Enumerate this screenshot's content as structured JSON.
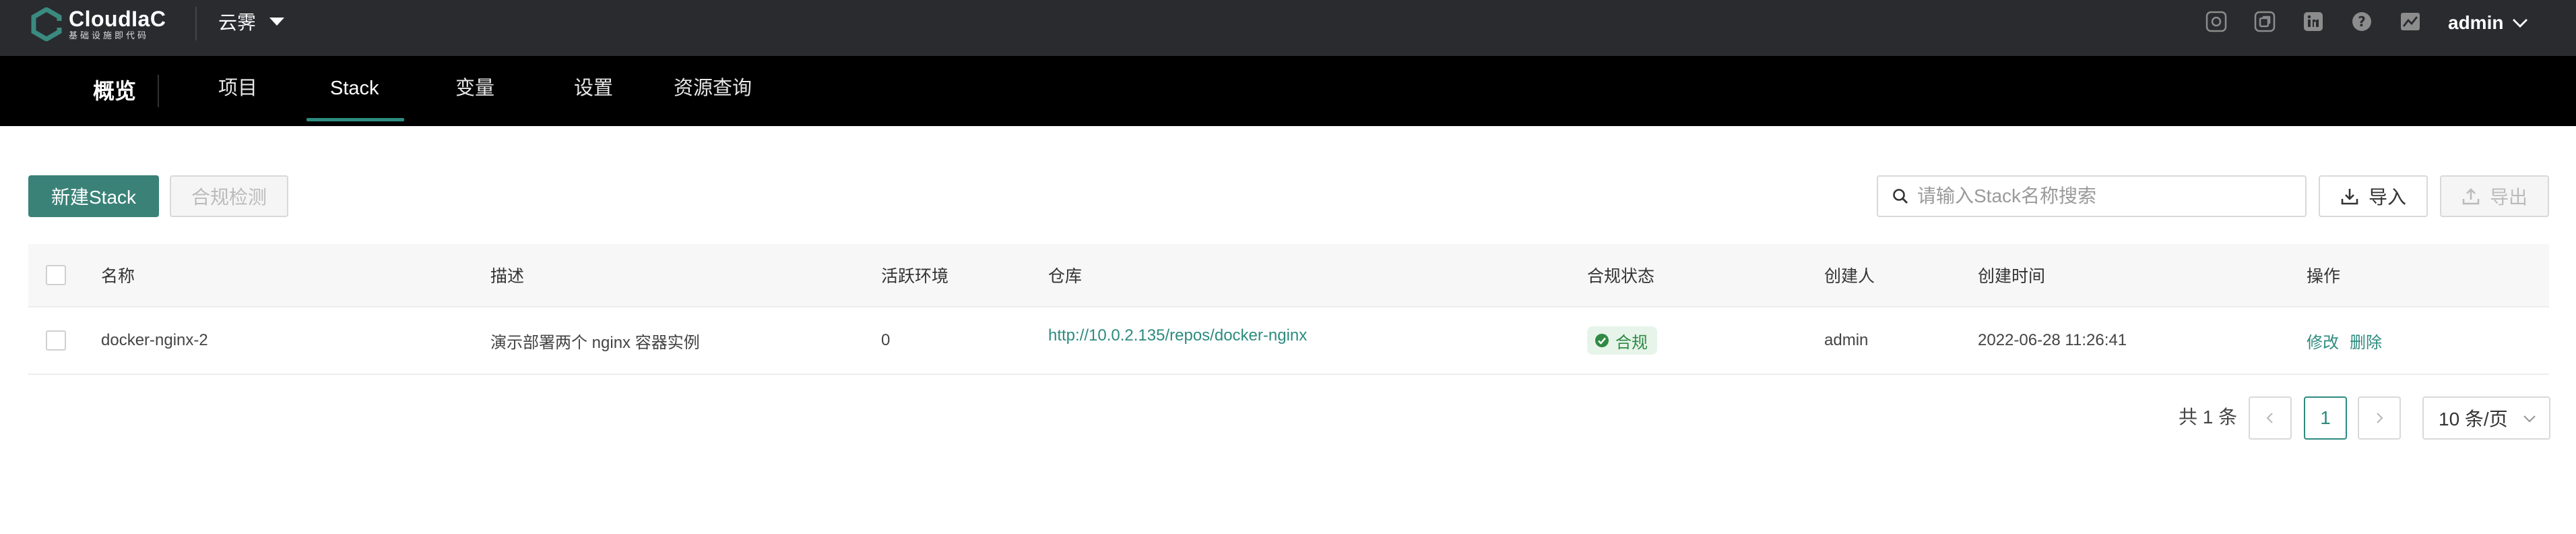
{
  "app": {
    "logo_title": "CloudIaC",
    "logo_subtitle": "基础设施即代码",
    "org": "云霁",
    "user": "admin"
  },
  "top_icons": [
    "gear-icon",
    "copy-icon",
    "linkedin-icon",
    "help-icon",
    "chart-icon"
  ],
  "nav": {
    "overview": "概览",
    "tabs": [
      {
        "label": "项目",
        "active": false
      },
      {
        "label": "Stack",
        "active": true
      },
      {
        "label": "变量",
        "active": false
      },
      {
        "label": "设置",
        "active": false
      },
      {
        "label": "资源查询",
        "active": false
      }
    ]
  },
  "toolbar": {
    "new_stack": "新建Stack",
    "compliance_check": "合规检测",
    "search_placeholder": "请输入Stack名称搜索",
    "import": "导入",
    "export": "导出"
  },
  "table": {
    "columns": [
      "名称",
      "描述",
      "活跃环境",
      "仓库",
      "合规状态",
      "创建人",
      "创建时间",
      "操作"
    ],
    "rows": [
      {
        "name": "docker-nginx-2",
        "description": "演示部署两个 nginx 容器实例",
        "active_envs": "0",
        "repo": "http://10.0.2.135/repos/docker-nginx",
        "compliance": "合规",
        "creator": "admin",
        "created_at": "2022-06-28 11:26:41",
        "actions": [
          "修改",
          "删除"
        ]
      }
    ]
  },
  "pagination": {
    "total": "共 1 条",
    "current_page": "1",
    "page_size": "10 条/页"
  },
  "colors": {
    "topbar": "#2a2b2f",
    "navbar": "#000000",
    "accent": "#2d8b7f",
    "primary_button": "#3a8278",
    "compliant_tag_bg": "#e7f4ea",
    "compliant_tag_text": "#2f8a43"
  }
}
